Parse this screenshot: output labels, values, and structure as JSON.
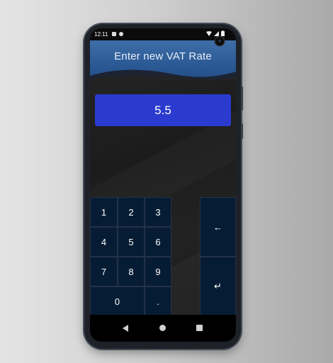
{
  "status_bar": {
    "time": "12:11"
  },
  "header": {
    "title": "Enter new VAT Rate"
  },
  "display": {
    "value": "5.5"
  },
  "keypad": {
    "k1": "1",
    "k2": "2",
    "k3": "3",
    "k4": "4",
    "k5": "5",
    "k6": "6",
    "k7": "7",
    "k8": "8",
    "k9": "9",
    "k0": "0",
    "dot": ".",
    "backspace": "←",
    "enter": "↵"
  },
  "colors": {
    "header": "#2b5a95",
    "display": "#2b3bcf",
    "key": "#061c34"
  }
}
